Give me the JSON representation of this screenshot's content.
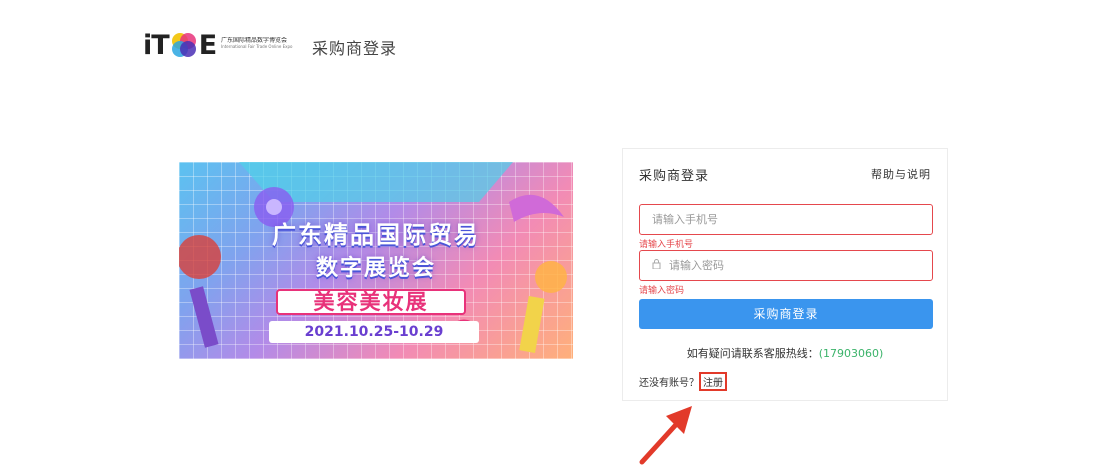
{
  "header": {
    "logo_text_left": "iT",
    "logo_text_right": "E",
    "logo_cn": "广东国际精品数字博览会",
    "logo_en": "International Fair Trade Online Expo",
    "portal_title": "采购商登录"
  },
  "banner": {
    "title_line1": "广东精品国际贸易",
    "title_line2": "数字展览会",
    "tag": "美容美妆展",
    "dates": "2021.10.25-10.29"
  },
  "login": {
    "title": "采购商登录",
    "help_link": "帮助与说明",
    "account_placeholder": "请输入手机号",
    "account_error": "请输入手机号",
    "password_placeholder": "请输入密码",
    "password_error": "请输入密码",
    "submit_label": "采购商登录",
    "contact_text": "如有疑问请联系客服热线：",
    "contact_phone": "(17903060)",
    "register_prompt": "还没有账号？",
    "register_link": "注册"
  },
  "colors": {
    "accent": "#3a95ee",
    "error": "#e5484d",
    "highlight_box": "#e23a2a",
    "phone": "#3bb36a"
  }
}
